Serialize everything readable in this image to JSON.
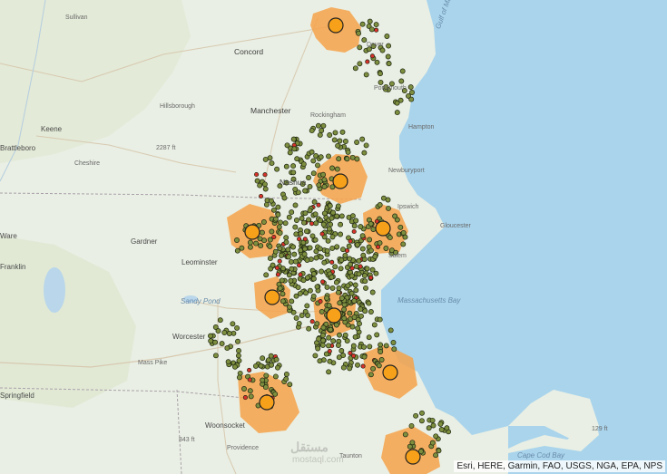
{
  "attribution": "Esri, HERE, Garmin, FAO, USGS, NGA, EPA, NPS",
  "watermark": {
    "ar": "مستقل",
    "en": "mostaql.com"
  },
  "places": [
    {
      "name": "Sullivan"
    },
    {
      "name": "Concord"
    },
    {
      "name": "Manchester"
    },
    {
      "name": "Hillsborough"
    },
    {
      "name": "Rockingham"
    },
    {
      "name": "Keene"
    },
    {
      "name": "Brattleboro"
    },
    {
      "name": "Cheshire"
    },
    {
      "name": "Nashua"
    },
    {
      "name": "Portsmouth"
    },
    {
      "name": "Hampton"
    },
    {
      "name": "Newburyport"
    },
    {
      "name": "Ipswich"
    },
    {
      "name": "Gloucester"
    },
    {
      "name": "Salem"
    },
    {
      "name": "Gardner"
    },
    {
      "name": "Leominster"
    },
    {
      "name": "Worcester"
    },
    {
      "name": "Sandy Pond"
    },
    {
      "name": "Mass Pike"
    },
    {
      "name": "Woonsocket"
    },
    {
      "name": "Providence"
    },
    {
      "name": "Taunton"
    },
    {
      "name": "Springfield"
    },
    {
      "name": "Dover"
    },
    {
      "name": "Massachusetts Bay"
    },
    {
      "name": "Cape Cod Bay"
    },
    {
      "name": "Gulf of Maine Coastal Plain"
    },
    {
      "name": "2287 ft"
    },
    {
      "name": "843 ft"
    },
    {
      "name": "129 ft"
    },
    {
      "name": "Ware"
    },
    {
      "name": "Franklin"
    }
  ],
  "colors": {
    "land": "#e9efe4",
    "ocean": "#a9d4ec",
    "point_fill": "#7d8f3f",
    "hub_fill": "#f7a11a",
    "halo": "#f6a24a",
    "red_dot": "#d6322b"
  }
}
